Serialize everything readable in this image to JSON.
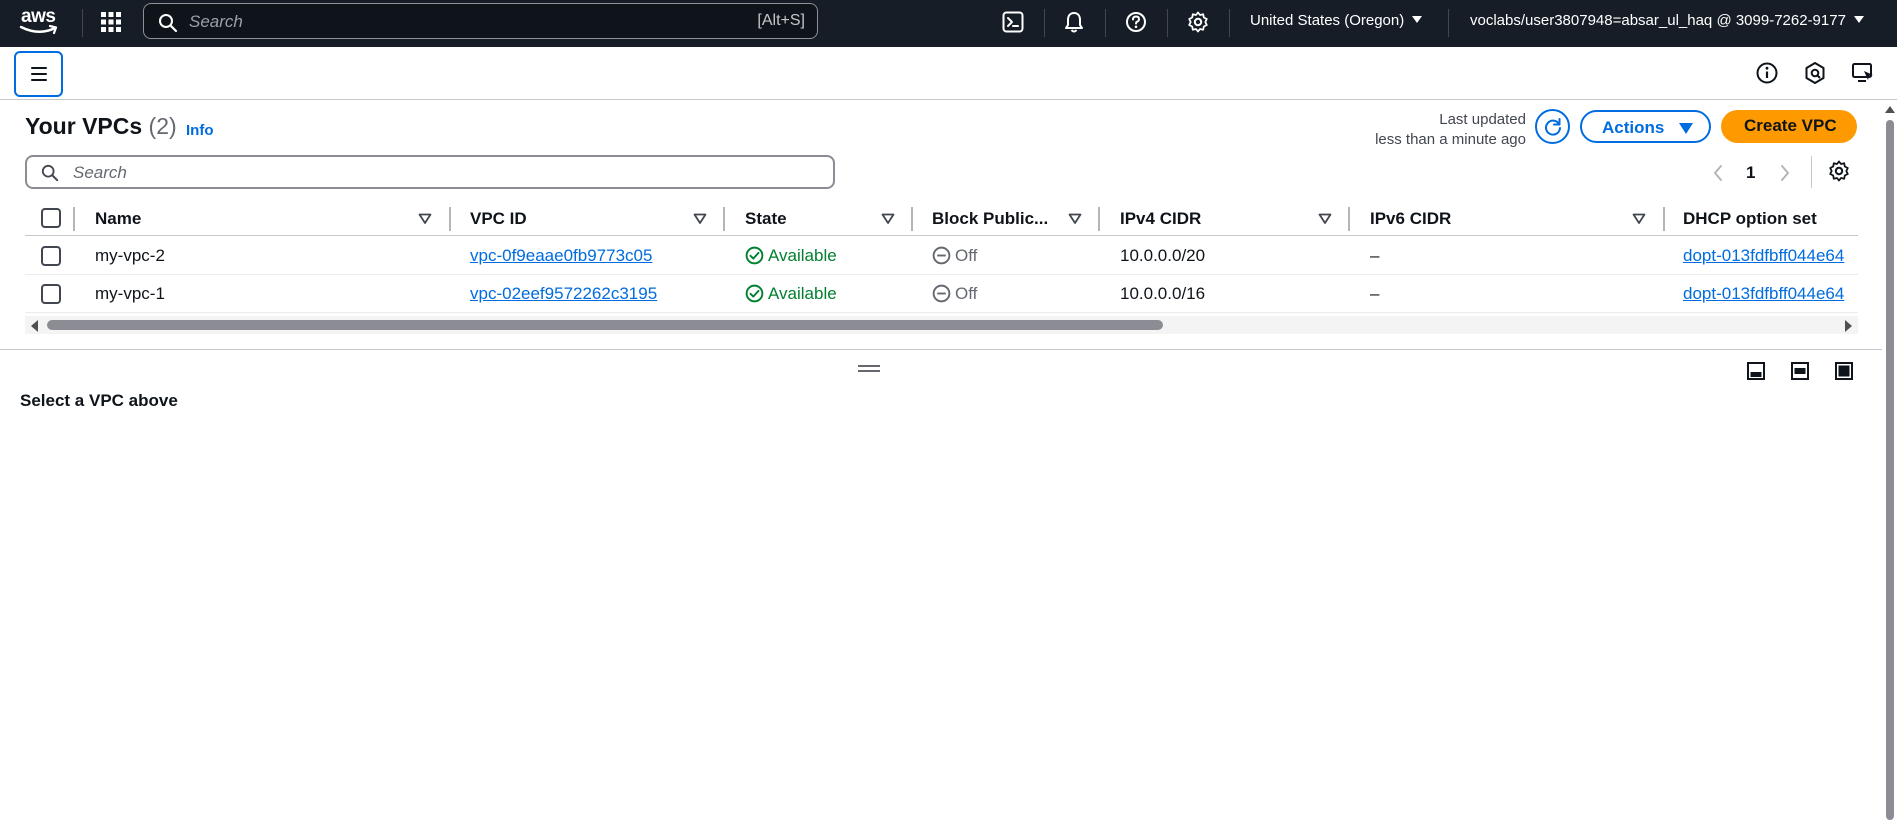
{
  "topbar": {
    "logo_text": "aws",
    "search_placeholder": "Search",
    "search_shortcut": "[Alt+S]",
    "region": "United States (Oregon)",
    "account": "voclabs/user3807948=absar_ul_haq @ 3099-7262-9177",
    "icons": [
      "apps-grid-icon",
      "cloudshell-icon",
      "notifications-bell-icon",
      "help-icon",
      "settings-gear-icon"
    ]
  },
  "subbar": {
    "icons": [
      "hamburger-menu-icon",
      "info-icon",
      "security-icon",
      "display-icon"
    ]
  },
  "header": {
    "title": "Your VPCs",
    "count": "(2)",
    "info_link": "Info",
    "last_updated_label": "Last updated",
    "last_updated_value": "less than a minute ago",
    "actions_label": "Actions",
    "create_label": "Create VPC"
  },
  "filter": {
    "search_placeholder": "Search",
    "page": "1"
  },
  "table": {
    "columns": [
      "Name",
      "VPC ID",
      "State",
      "Block Public...",
      "IPv4 CIDR",
      "IPv6 CIDR",
      "DHCP option set"
    ],
    "rows": [
      {
        "name": "my-vpc-2",
        "vpc_id": "vpc-0f9eaae0fb9773c05",
        "state": "Available",
        "block_public": "Off",
        "ipv4": "10.0.0.0/20",
        "ipv6": "–",
        "dhcp": "dopt-013fdfbff044e64"
      },
      {
        "name": "my-vpc-1",
        "vpc_id": "vpc-02eef9572262c3195",
        "state": "Available",
        "block_public": "Off",
        "ipv4": "10.0.0.0/16",
        "ipv6": "–",
        "dhcp": "dopt-013fdfbff044e64"
      }
    ]
  },
  "split_panel": {
    "message": "Select a VPC above"
  },
  "colors": {
    "topbar_bg": "#161d26",
    "link": "#006ce0",
    "primary_button": "#ff9900",
    "status_available": "#00802f"
  }
}
